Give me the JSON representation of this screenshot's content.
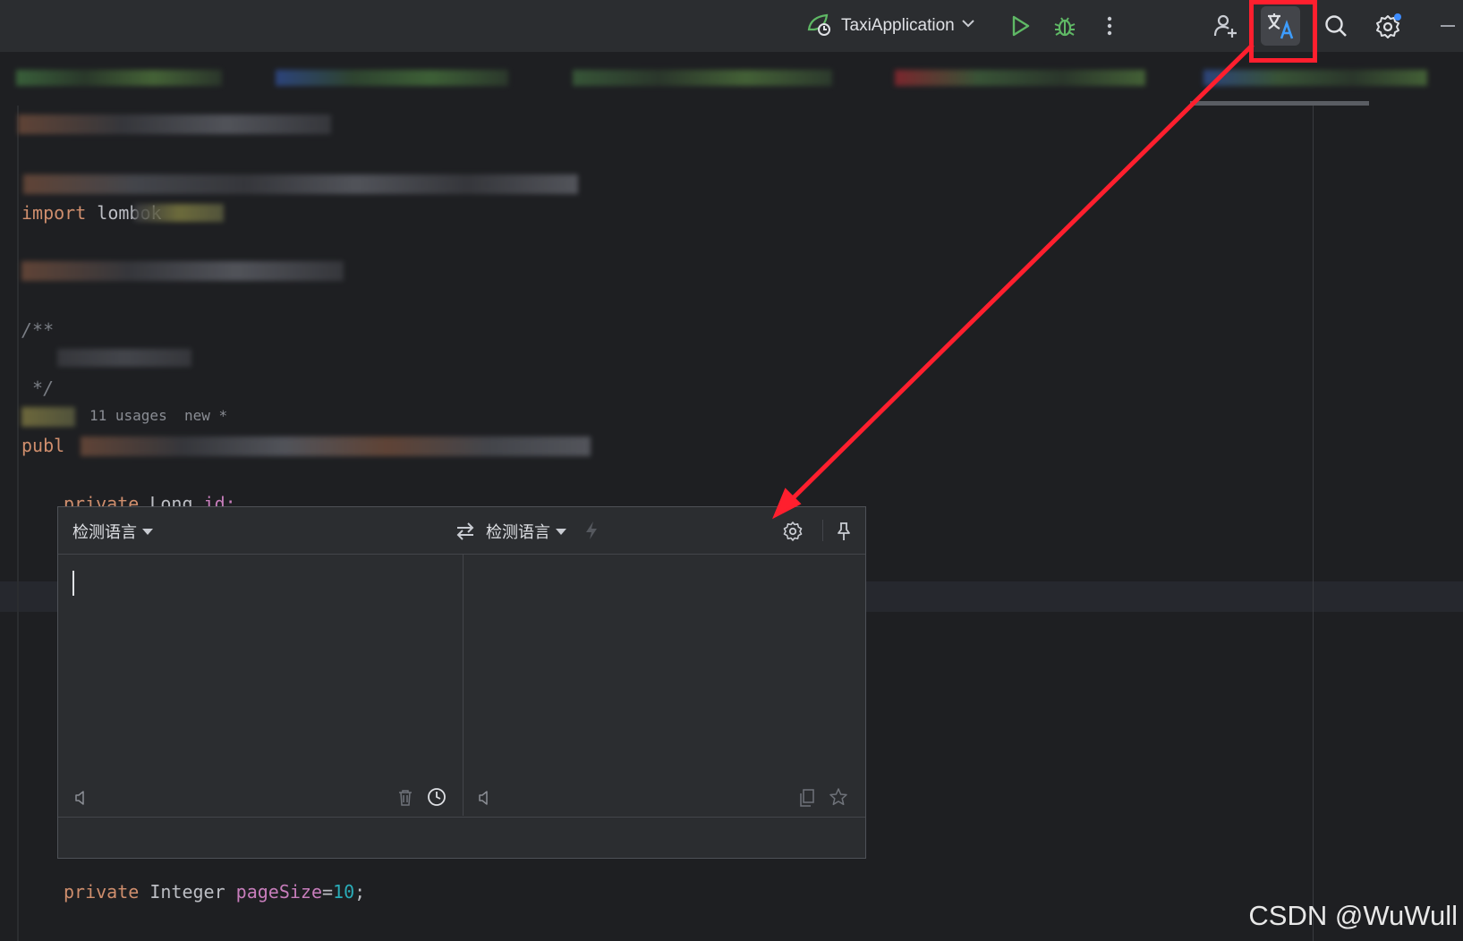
{
  "toolbar": {
    "run_config_label": "TaxiApplication",
    "icons": [
      "spring-boot-icon",
      "chevron-down-icon",
      "run-icon",
      "debug-icon",
      "more-vertical-icon",
      "add-user-icon",
      "translate-icon",
      "search-icon",
      "settings-icon",
      "minimize-icon"
    ]
  },
  "code": {
    "import_keyword": "import",
    "import_rest": " lombok",
    "doc_open": "/**",
    "doc_close": " */",
    "usages_hint": "11 usages  new *",
    "public_keyword": "publ",
    "field1_kw": "private",
    "field1_type": " Long",
    "field1_name": " id;",
    "field2_kw": "private",
    "field2_type": " Integer",
    "field2_name": " pageSize",
    "field2_eq": "=",
    "field2_val": "10",
    "field2_end": ";"
  },
  "translator": {
    "source_lang": "检测语言",
    "target_lang": "检测语言",
    "source_text": "",
    "result_text": ""
  },
  "watermark": "CSDN @WuWull",
  "colors": {
    "accent_red": "#ff1f2e",
    "run_green": "#5fb865"
  }
}
